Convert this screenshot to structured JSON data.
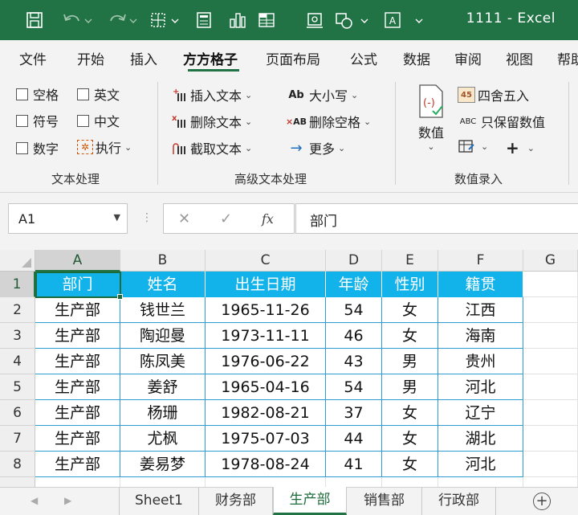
{
  "window": {
    "title": "1111  -  Excel"
  },
  "ribbon_tabs": [
    "文件",
    "开始",
    "插入",
    "方方格子",
    "页面布局",
    "公式",
    "数据",
    "审阅",
    "视图",
    "帮助"
  ],
  "active_tab": "方方格子",
  "ribbon": {
    "text_group": {
      "label": "文本处理",
      "checkboxes": [
        "空格",
        "英文",
        "符号",
        "中文",
        "数字"
      ],
      "execute": "执行"
    },
    "advanced_group": {
      "label": "高级文本处理",
      "insert_text": "插入文本",
      "delete_text": "删除文本",
      "extract_text": "截取文本",
      "case": "大小写",
      "delete_space": "删除空格",
      "more": "更多"
    },
    "numeric_group": {
      "label": "数值录入",
      "numeric": "数值",
      "round": "四舍五入",
      "keep_values": "只保留数值"
    }
  },
  "formula_bar": {
    "name_box": "A1",
    "value": "部门",
    "fx": "fx"
  },
  "grid": {
    "columns": [
      "A",
      "B",
      "C",
      "D",
      "E",
      "F",
      "G"
    ],
    "rows": [
      "1",
      "2",
      "3",
      "4",
      "5",
      "6",
      "7",
      "8"
    ],
    "header": [
      "部门",
      "姓名",
      "出生日期",
      "年龄",
      "性别",
      "籍贯"
    ],
    "data": [
      [
        "生产部",
        "钱世兰",
        "1965-11-26",
        "54",
        "女",
        "江西"
      ],
      [
        "生产部",
        "陶迎曼",
        "1973-11-11",
        "46",
        "女",
        "海南"
      ],
      [
        "生产部",
        "陈凤美",
        "1976-06-22",
        "43",
        "男",
        "贵州"
      ],
      [
        "生产部",
        "姜舒",
        "1965-04-16",
        "54",
        "男",
        "河北"
      ],
      [
        "生产部",
        "杨珊",
        "1982-08-21",
        "37",
        "女",
        "辽宁"
      ],
      [
        "生产部",
        "尤枫",
        "1975-07-03",
        "44",
        "女",
        "湖北"
      ],
      [
        "生产部",
        "姜易梦",
        "1978-08-24",
        "41",
        "女",
        "河北"
      ]
    ]
  },
  "sheets": [
    "Sheet1",
    "财务部",
    "生产部",
    "销售部",
    "行政部"
  ],
  "active_sheet": "生产部",
  "colors": {
    "excel_green": "#217346",
    "header_fill": "#12b3ea",
    "cell_border": "#2f9cd4"
  }
}
